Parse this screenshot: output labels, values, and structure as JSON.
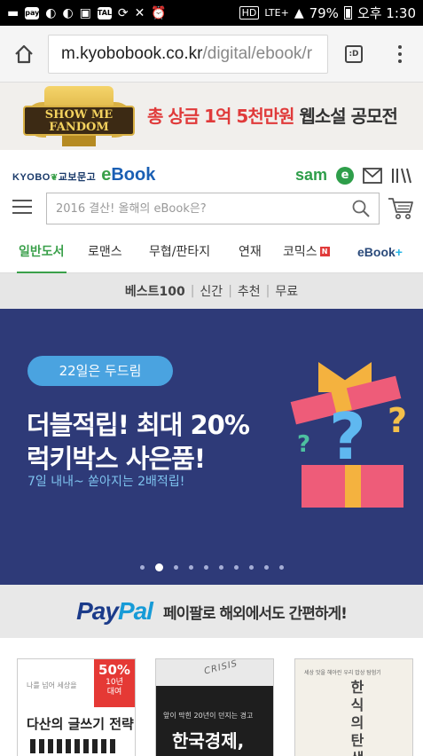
{
  "status_bar": {
    "left_icons": [
      "message-icon",
      "pay-icon",
      "d-app-icon",
      "d-app-icon",
      "image-icon",
      "talk-icon",
      "sync-icon",
      "mute-icon",
      "alarm-icon"
    ],
    "hd": "HD",
    "network": "LTE+",
    "battery": "79%",
    "time": "오후 1:30"
  },
  "browser": {
    "url_host": "m.kyobobook.co.kr",
    "url_path": "/digital/ebook/r",
    "tab_label": ":D"
  },
  "top_banner": {
    "badge_line1": "SHOW ME",
    "badge_line2": "FANDOM",
    "title_red": "총 상금 1억 5천만원",
    "title_dark": "웹소설 공모전"
  },
  "header": {
    "logo_kyobo": "KYOBO",
    "logo_kyobo_kr": "교보문고",
    "logo_ebook_e": "e",
    "logo_ebook_rest": "Book",
    "sam_label": "sam",
    "sam_badge": "e"
  },
  "search": {
    "placeholder": "2016 결산! 올해의 eBook은?"
  },
  "category_tabs": [
    {
      "label": "일반도서",
      "active": true
    },
    {
      "label": "로맨스"
    },
    {
      "label": "무협/판타지"
    },
    {
      "label": "연재"
    },
    {
      "label": "코믹스",
      "badge": "N"
    },
    {
      "label_main": "eBook",
      "label_plus": "+"
    }
  ],
  "sub_tabs": [
    "베스트100",
    "신간",
    "추천",
    "무료"
  ],
  "promo": {
    "pill": "22일은 두드림",
    "headline1": "더블적립! 최대 20%",
    "headline2": "럭키박스 사은품!",
    "subtitle": "7일 내내~ 쏟아지는 2배적립!",
    "slide_count": 10,
    "active_slide": 2
  },
  "paypal": {
    "logo_pay": "Pay",
    "logo_pal": "Pal",
    "text": "페이팔로 해외에서도 간편하게!"
  },
  "books": [
    {
      "title": "다산의 글쓰기 전략",
      "small_text": "나를 넘어 세상을",
      "badge_pct": "50%",
      "badge_line1": "10년",
      "badge_line2": "대여"
    },
    {
      "title": "한국경제,",
      "small_text": "CRISIS",
      "subtitle": "앞이 막힌 20년이 던지는 경고"
    },
    {
      "title": "한식의 탄생",
      "small_text": "세상 맛을 헤아린 우리 밥상 탐험기"
    }
  ],
  "colors": {
    "brand_green": "#3aa04a",
    "brand_blue": "#1a5fb4",
    "promo_bg": "#2e3a78",
    "paypal_blue": "#1b3b8a",
    "red": "#e03a3a"
  }
}
